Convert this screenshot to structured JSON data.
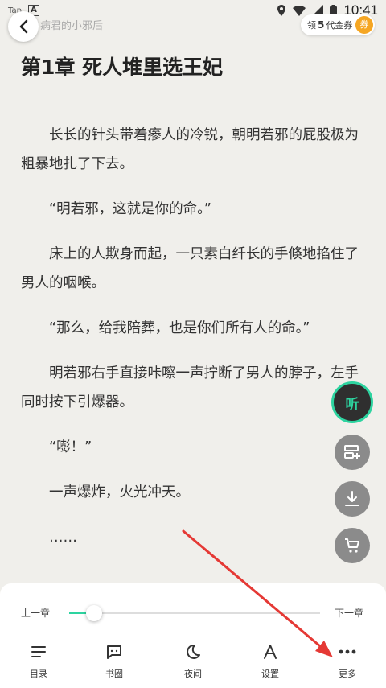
{
  "status_bar": {
    "left_label": "Tap",
    "left_badge": "A",
    "time": "10:41"
  },
  "header": {
    "book_title": "病君的小邪后",
    "coupon_prefix": "领",
    "coupon_count": "5",
    "coupon_suffix": "代金券",
    "coupon_badge": "券"
  },
  "chapter": {
    "title": "第1章 死人堆里选王妃",
    "paragraphs": [
      "长长的针头带着瘆人的冷锐，朝明若邪的屁股极为粗暴地扎了下去。",
      "“明若邪，这就是你的命。”",
      "床上的人欺身而起，一只素白纤长的手倏地掐住了男人的咽喉。",
      "“那么，给我陪葬，也是你们所有人的命。”",
      "明若邪右手直接咔嚓一声拧断了男人的脖子，左手同时按下引爆器。",
      "“嘭！”",
      "一声爆炸，火光冲天。",
      "……"
    ]
  },
  "floating": {
    "listen_label": "听",
    "icons": [
      "add-to-shelf-icon",
      "download-icon",
      "cart-icon"
    ]
  },
  "bottom_panel": {
    "prev_chapter": "上一章",
    "next_chapter": "下一章",
    "progress": 0.1,
    "nav": [
      {
        "label": "目录",
        "icon": "catalog-icon"
      },
      {
        "label": "书圈",
        "icon": "book-circle-icon"
      },
      {
        "label": "夜间",
        "icon": "night-mode-icon"
      },
      {
        "label": "设置",
        "icon": "settings-icon"
      },
      {
        "label": "更多",
        "icon": "more-icon"
      }
    ]
  },
  "colors": {
    "accent": "#2dd4a0",
    "annotation_arrow": "#e53935"
  }
}
